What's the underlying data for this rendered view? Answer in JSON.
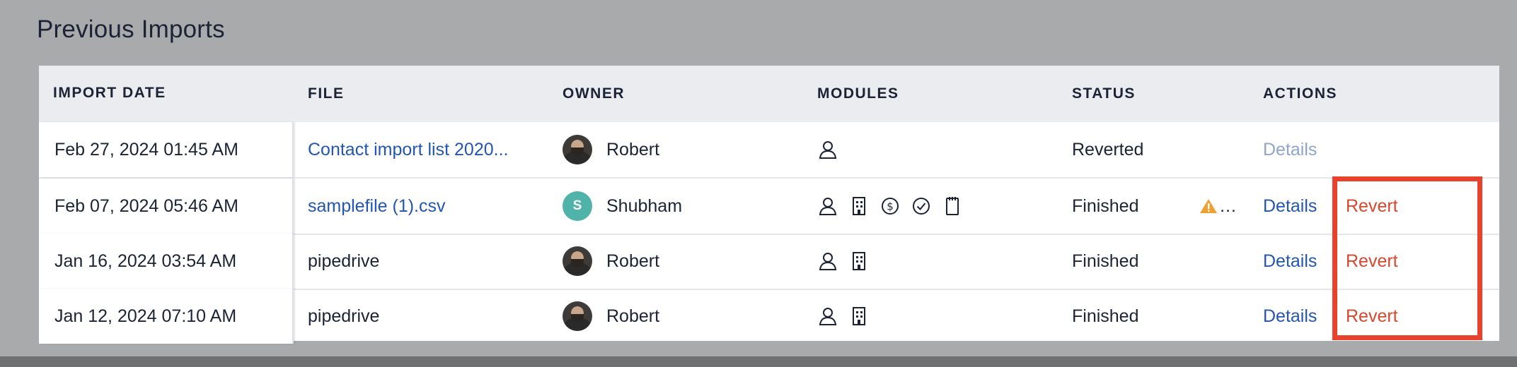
{
  "page": {
    "title": "Previous Imports"
  },
  "table": {
    "headers": {
      "import_date": "IMPORT DATE",
      "file": "FILE",
      "owner": "OWNER",
      "modules": "MODULES",
      "status": "STATUS",
      "actions": "ACTIONS"
    },
    "rows": [
      {
        "date": "Feb 27, 2024 01:45 AM",
        "file": "Contact import list 2020...",
        "file_is_link": true,
        "owner": "Robert",
        "owner_avatar": "photo",
        "modules": [
          "person-icon"
        ],
        "status": "Reverted",
        "warning": "",
        "details": "Details",
        "revert": ""
      },
      {
        "date": "Feb 07, 2024 05:46 AM",
        "file": "samplefile (1).csv",
        "file_is_link": true,
        "owner": "Shubham",
        "owner_avatar": "S",
        "modules": [
          "person-icon",
          "building-icon",
          "dollar-icon",
          "check-circle-icon",
          "notepad-icon"
        ],
        "status": "Finished",
        "warning": "…",
        "details": "Details",
        "revert": "Revert"
      },
      {
        "date": "Jan 16, 2024 03:54 AM",
        "file": "pipedrive",
        "file_is_link": false,
        "owner": "Robert",
        "owner_avatar": "photo",
        "modules": [
          "person-icon",
          "building-icon"
        ],
        "status": "Finished",
        "warning": "",
        "details": "Details",
        "revert": "Revert"
      },
      {
        "date": "Jan 12, 2024 07:10 AM",
        "file": "pipedrive",
        "file_is_link": false,
        "owner": "Robert",
        "owner_avatar": "photo",
        "modules": [
          "person-icon",
          "building-icon"
        ],
        "status": "Finished",
        "warning": "",
        "details": "Details",
        "revert": "Revert"
      }
    ]
  },
  "colors": {
    "link": "#2356b3",
    "revert": "#d9472e",
    "highlight": "#e8412c",
    "warning": "#f0a030"
  }
}
